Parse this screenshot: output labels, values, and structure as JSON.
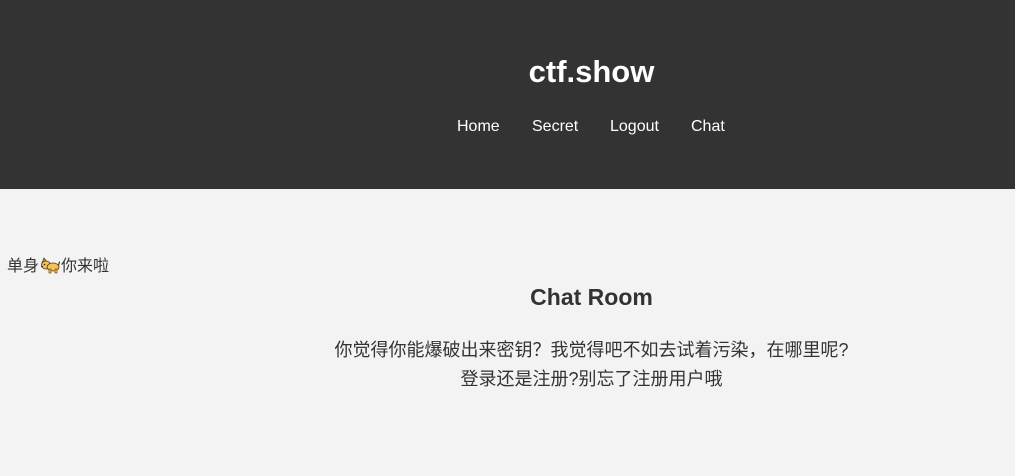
{
  "header": {
    "title": "ctf.show",
    "nav": [
      "Home",
      "Secret",
      "Logout",
      "Chat"
    ]
  },
  "side_note": {
    "before": "单身",
    "icon": "dog-icon",
    "after": "你来啦"
  },
  "main": {
    "heading": "Chat Room",
    "lines": [
      "你觉得你能爆破出来密钥？我觉得吧不如去试着污染，在哪里呢?",
      "登录还是注册?别忘了注册用户哦"
    ]
  },
  "colors": {
    "header_bg": "#333333",
    "page_bg": "#f3f3f3",
    "text": "#333333",
    "header_text": "#ffffff"
  }
}
